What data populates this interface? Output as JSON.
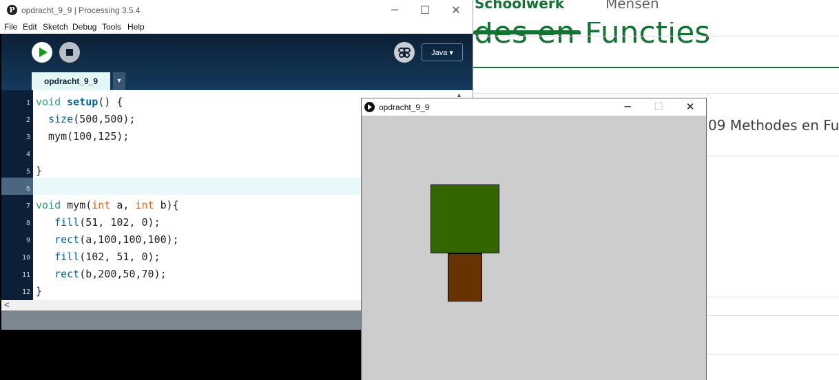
{
  "background_page": {
    "tabs": [
      "Schoolwerk",
      "Mensen"
    ],
    "big_title_fragment": "des en Functies",
    "topic_title": "09 Methodes en Fu"
  },
  "ide": {
    "window_title": "opdracht_9_9 | Processing 3.5.4",
    "logo_letter": "P",
    "menu": [
      "File",
      "Edit",
      "Sketch",
      "Debug",
      "Tools",
      "Help"
    ],
    "mode": "Java ▾",
    "tab_name": "opdracht_9_9",
    "tab_menu_glyph": "▾",
    "line_numbers": [
      "1",
      "2",
      "3",
      "4",
      "5",
      "6",
      "7",
      "8",
      "9",
      "10",
      "11",
      "12"
    ],
    "code_lines": [
      "void setup() {",
      "  size(500,500);",
      "  mym(100,125);",
      "",
      "}",
      "",
      "void mym(int a, int b){",
      "   fill(51, 102, 0);",
      "   rect(a,100,100,100);",
      "   fill(102, 51, 0);",
      "   rect(b,200,50,70);",
      "}"
    ],
    "current_line": 6
  },
  "sketch": {
    "window_title": "opdracht_9_9",
    "canvas_bg": "#cccccc",
    "canopy_color": "#336600",
    "trunk_color": "#663300",
    "mym_args": [
      100,
      125
    ]
  },
  "colors": {
    "classroom_green": "#137333",
    "ide_dark": "#0b2036"
  }
}
